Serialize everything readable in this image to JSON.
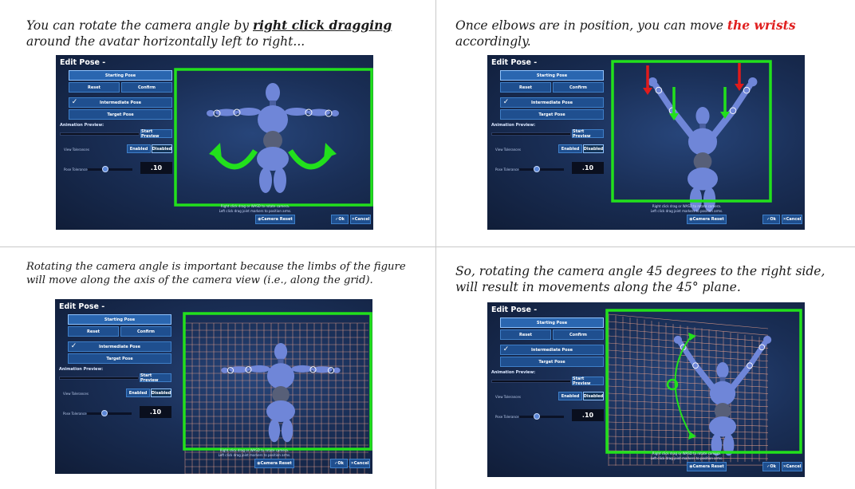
{
  "captions": {
    "top_left": {
      "before": "You can rotate the camera angle by ",
      "emphasis": "right click dragging",
      "after": " around the avatar horizontally left to right..."
    },
    "top_right": {
      "before": "Once elbows are in position, you can move ",
      "emphasis": "the wrists",
      "after": " accordingly."
    },
    "bottom_left": "Rotating the camera angle is important because the limbs of the figure will move along the axis of the camera view (i.e., along the grid).",
    "bottom_right": "So, rotating the camera angle 45 degrees to the right side, will result in movements along the 45° plane."
  },
  "panel": {
    "title": "Edit Pose -",
    "starting_pose": "Starting Pose",
    "reset": "Reset",
    "confirm": "Confirm",
    "intermediate_pose": "Intermediate Pose",
    "target_pose": "Target Pose",
    "animation_preview": "Animation Preview:",
    "start_preview": "Start Preview",
    "view_tolerances": "View Tolerances",
    "enabled": "Enabled",
    "disabled": "Disabled",
    "pose_tolerance": "Pose Tolerance",
    "tolerance_value": ".10",
    "hint_line1": "Right click drag or WASD to rotate camera.",
    "hint_line2": "Left click drag joint markers to position arms.",
    "camera_reset": "Camera Reset",
    "ok": "Ok",
    "cancel": "Cancel",
    "checkmark": "✓"
  },
  "colors": {
    "highlight_box": "#22e01c",
    "green_arrow": "#22e01c",
    "red_arrow": "#e01b1b",
    "grid_line": "#e8a08a",
    "avatar": "#6f86d8",
    "background": "#1a2f57"
  }
}
